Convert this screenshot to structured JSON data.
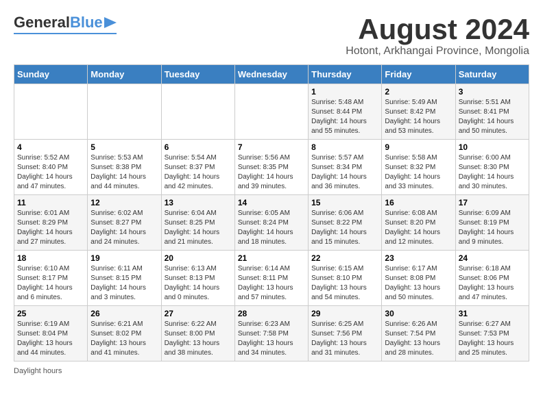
{
  "header": {
    "logo_general": "General",
    "logo_blue": "Blue",
    "title": "August 2024",
    "subtitle": "Hotont, Arkhangai Province, Mongolia"
  },
  "calendar": {
    "weekdays": [
      "Sunday",
      "Monday",
      "Tuesday",
      "Wednesday",
      "Thursday",
      "Friday",
      "Saturday"
    ],
    "weeks": [
      [
        {
          "day": "",
          "info": ""
        },
        {
          "day": "",
          "info": ""
        },
        {
          "day": "",
          "info": ""
        },
        {
          "day": "",
          "info": ""
        },
        {
          "day": "1",
          "info": "Sunrise: 5:48 AM\nSunset: 8:44 PM\nDaylight: 14 hours\nand 55 minutes."
        },
        {
          "day": "2",
          "info": "Sunrise: 5:49 AM\nSunset: 8:42 PM\nDaylight: 14 hours\nand 53 minutes."
        },
        {
          "day": "3",
          "info": "Sunrise: 5:51 AM\nSunset: 8:41 PM\nDaylight: 14 hours\nand 50 minutes."
        }
      ],
      [
        {
          "day": "4",
          "info": "Sunrise: 5:52 AM\nSunset: 8:40 PM\nDaylight: 14 hours\nand 47 minutes."
        },
        {
          "day": "5",
          "info": "Sunrise: 5:53 AM\nSunset: 8:38 PM\nDaylight: 14 hours\nand 44 minutes."
        },
        {
          "day": "6",
          "info": "Sunrise: 5:54 AM\nSunset: 8:37 PM\nDaylight: 14 hours\nand 42 minutes."
        },
        {
          "day": "7",
          "info": "Sunrise: 5:56 AM\nSunset: 8:35 PM\nDaylight: 14 hours\nand 39 minutes."
        },
        {
          "day": "8",
          "info": "Sunrise: 5:57 AM\nSunset: 8:34 PM\nDaylight: 14 hours\nand 36 minutes."
        },
        {
          "day": "9",
          "info": "Sunrise: 5:58 AM\nSunset: 8:32 PM\nDaylight: 14 hours\nand 33 minutes."
        },
        {
          "day": "10",
          "info": "Sunrise: 6:00 AM\nSunset: 8:30 PM\nDaylight: 14 hours\nand 30 minutes."
        }
      ],
      [
        {
          "day": "11",
          "info": "Sunrise: 6:01 AM\nSunset: 8:29 PM\nDaylight: 14 hours\nand 27 minutes."
        },
        {
          "day": "12",
          "info": "Sunrise: 6:02 AM\nSunset: 8:27 PM\nDaylight: 14 hours\nand 24 minutes."
        },
        {
          "day": "13",
          "info": "Sunrise: 6:04 AM\nSunset: 8:25 PM\nDaylight: 14 hours\nand 21 minutes."
        },
        {
          "day": "14",
          "info": "Sunrise: 6:05 AM\nSunset: 8:24 PM\nDaylight: 14 hours\nand 18 minutes."
        },
        {
          "day": "15",
          "info": "Sunrise: 6:06 AM\nSunset: 8:22 PM\nDaylight: 14 hours\nand 15 minutes."
        },
        {
          "day": "16",
          "info": "Sunrise: 6:08 AM\nSunset: 8:20 PM\nDaylight: 14 hours\nand 12 minutes."
        },
        {
          "day": "17",
          "info": "Sunrise: 6:09 AM\nSunset: 8:19 PM\nDaylight: 14 hours\nand 9 minutes."
        }
      ],
      [
        {
          "day": "18",
          "info": "Sunrise: 6:10 AM\nSunset: 8:17 PM\nDaylight: 14 hours\nand 6 minutes."
        },
        {
          "day": "19",
          "info": "Sunrise: 6:11 AM\nSunset: 8:15 PM\nDaylight: 14 hours\nand 3 minutes."
        },
        {
          "day": "20",
          "info": "Sunrise: 6:13 AM\nSunset: 8:13 PM\nDaylight: 14 hours\nand 0 minutes."
        },
        {
          "day": "21",
          "info": "Sunrise: 6:14 AM\nSunset: 8:11 PM\nDaylight: 13 hours\nand 57 minutes."
        },
        {
          "day": "22",
          "info": "Sunrise: 6:15 AM\nSunset: 8:10 PM\nDaylight: 13 hours\nand 54 minutes."
        },
        {
          "day": "23",
          "info": "Sunrise: 6:17 AM\nSunset: 8:08 PM\nDaylight: 13 hours\nand 50 minutes."
        },
        {
          "day": "24",
          "info": "Sunrise: 6:18 AM\nSunset: 8:06 PM\nDaylight: 13 hours\nand 47 minutes."
        }
      ],
      [
        {
          "day": "25",
          "info": "Sunrise: 6:19 AM\nSunset: 8:04 PM\nDaylight: 13 hours\nand 44 minutes."
        },
        {
          "day": "26",
          "info": "Sunrise: 6:21 AM\nSunset: 8:02 PM\nDaylight: 13 hours\nand 41 minutes."
        },
        {
          "day": "27",
          "info": "Sunrise: 6:22 AM\nSunset: 8:00 PM\nDaylight: 13 hours\nand 38 minutes."
        },
        {
          "day": "28",
          "info": "Sunrise: 6:23 AM\nSunset: 7:58 PM\nDaylight: 13 hours\nand 34 minutes."
        },
        {
          "day": "29",
          "info": "Sunrise: 6:25 AM\nSunset: 7:56 PM\nDaylight: 13 hours\nand 31 minutes."
        },
        {
          "day": "30",
          "info": "Sunrise: 6:26 AM\nSunset: 7:54 PM\nDaylight: 13 hours\nand 28 minutes."
        },
        {
          "day": "31",
          "info": "Sunrise: 6:27 AM\nSunset: 7:53 PM\nDaylight: 13 hours\nand 25 minutes."
        }
      ]
    ]
  },
  "footer": {
    "daylight_label": "Daylight hours"
  }
}
